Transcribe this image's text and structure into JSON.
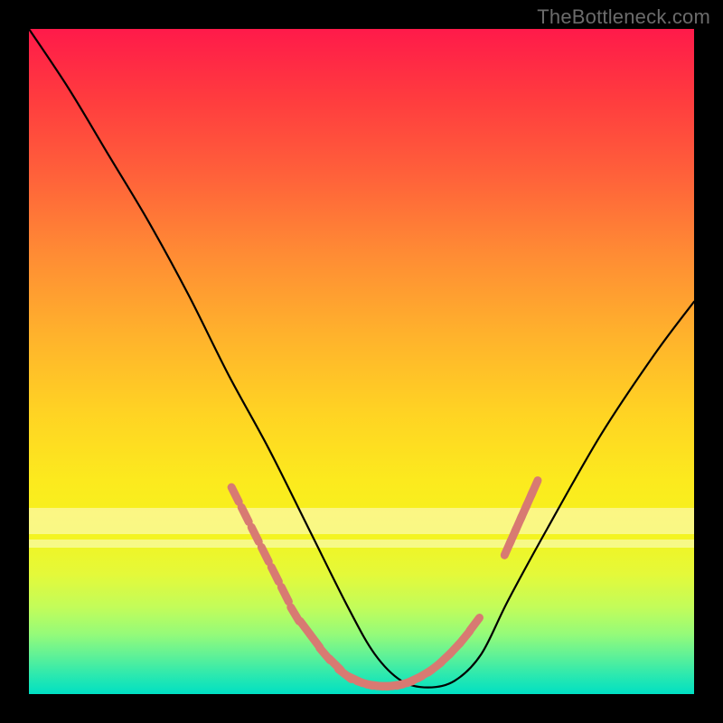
{
  "watermark": {
    "text": "TheBottleneck.com"
  },
  "chart_data": {
    "type": "line",
    "title": "",
    "xlabel": "",
    "ylabel": "",
    "xlim": [
      0,
      100
    ],
    "ylim": [
      0,
      100
    ],
    "grid": false,
    "legend": false,
    "series": [
      {
        "name": "bottleneck-curve",
        "x": [
          0,
          6,
          12,
          18,
          24,
          30,
          36,
          42,
          48,
          52,
          56,
          60,
          64,
          68,
          72,
          78,
          86,
          94,
          100
        ],
        "values": [
          100,
          91,
          81,
          71,
          60,
          48,
          37,
          25,
          13,
          6,
          2,
          1,
          2,
          6,
          14,
          25,
          39,
          51,
          59
        ]
      }
    ],
    "annotations": {
      "marker_clusters": [
        {
          "name": "left-cluster",
          "color": "#d87a72",
          "points": [
            [
              31,
              30
            ],
            [
              32.5,
              27
            ],
            [
              34,
              24
            ],
            [
              35.5,
              21
            ],
            [
              37,
              18
            ],
            [
              38.5,
              15
            ],
            [
              40,
              12
            ],
            [
              41.5,
              10
            ],
            [
              43,
              8
            ],
            [
              44.5,
              6
            ],
            [
              46,
              4.5
            ],
            [
              47.5,
              3
            ],
            [
              49,
              2.2
            ],
            [
              50.5,
              1.6
            ],
            [
              52,
              1.3
            ],
            [
              53.5,
              1.2
            ],
            [
              55,
              1.3
            ],
            [
              56.5,
              1.6
            ],
            [
              58,
              2.2
            ],
            [
              59.5,
              3
            ],
            [
              61,
              4
            ],
            [
              62.5,
              5.3
            ],
            [
              64,
              6.8
            ],
            [
              65.5,
              8.5
            ],
            [
              67,
              10.5
            ]
          ]
        },
        {
          "name": "right-cluster",
          "color": "#d87a72",
          "points": [
            [
              72,
              22
            ],
            [
              72.8,
              23.8
            ],
            [
              73.6,
              25.6
            ],
            [
              74.4,
              27.4
            ],
            [
              75.2,
              29.2
            ],
            [
              76,
              31
            ]
          ]
        }
      ],
      "faint_bands": [
        {
          "y": 24,
          "height": 4,
          "color": "#ffffff"
        },
        {
          "y": 22,
          "height": 1.2,
          "color": "#ffffff"
        }
      ]
    }
  }
}
